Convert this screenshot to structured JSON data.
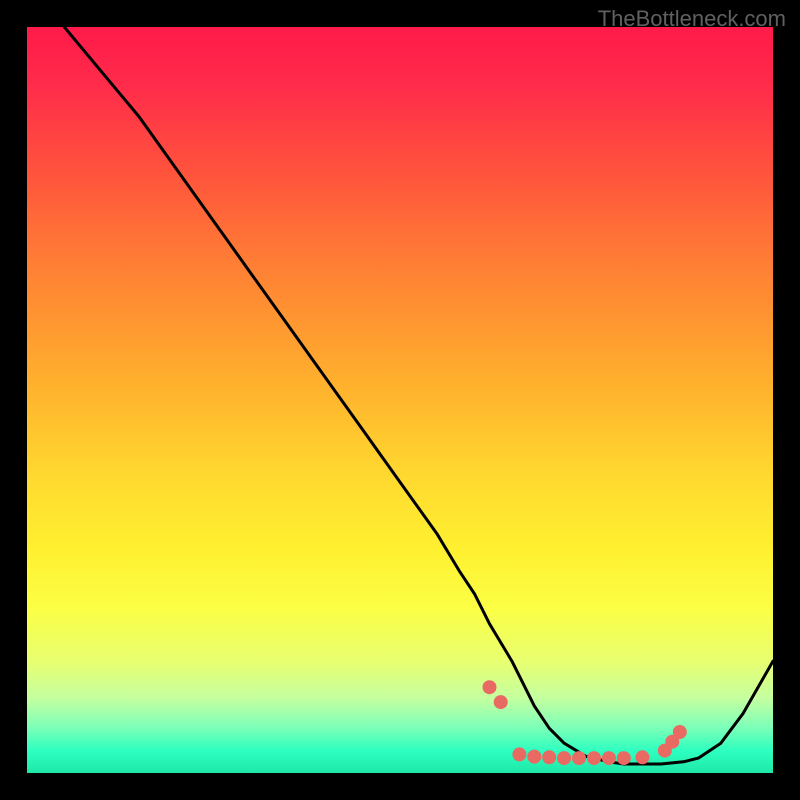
{
  "attribution": "TheBottleneck.com",
  "chart_data": {
    "type": "line",
    "title": "",
    "xlabel": "",
    "ylabel": "",
    "xlim": [
      0,
      100
    ],
    "ylim": [
      0,
      100
    ],
    "series": [
      {
        "name": "curve",
        "x": [
          5,
          10,
          15,
          20,
          25,
          30,
          35,
          40,
          45,
          50,
          55,
          58,
          60,
          62,
          65,
          68,
          70,
          72,
          75,
          78,
          80,
          82,
          85,
          88,
          90,
          93,
          96,
          100
        ],
        "y": [
          100,
          94,
          88,
          81,
          74,
          67,
          60,
          53,
          46,
          39,
          32,
          27,
          24,
          20,
          15,
          9,
          6,
          4,
          2.2,
          1.5,
          1.2,
          1.2,
          1.2,
          1.5,
          2,
          4,
          8,
          15
        ]
      }
    ],
    "markers": {
      "x": [
        62,
        63.5,
        66,
        68,
        70,
        72,
        74,
        76,
        78,
        80,
        82.5,
        85.5,
        86.5,
        87.5
      ],
      "y": [
        11.5,
        9.5,
        2.5,
        2.2,
        2.1,
        2.0,
        2.0,
        2.0,
        2.0,
        2.0,
        2.1,
        3.0,
        4.2,
        5.5
      ],
      "color": "#e96a62",
      "radius": 7
    },
    "gradient_stops": [
      {
        "pos": 0,
        "color": "#ff1a4a"
      },
      {
        "pos": 50,
        "color": "#ffd82f"
      },
      {
        "pos": 85,
        "color": "#e8ff70"
      },
      {
        "pos": 100,
        "color": "#1ee8a8"
      }
    ]
  }
}
